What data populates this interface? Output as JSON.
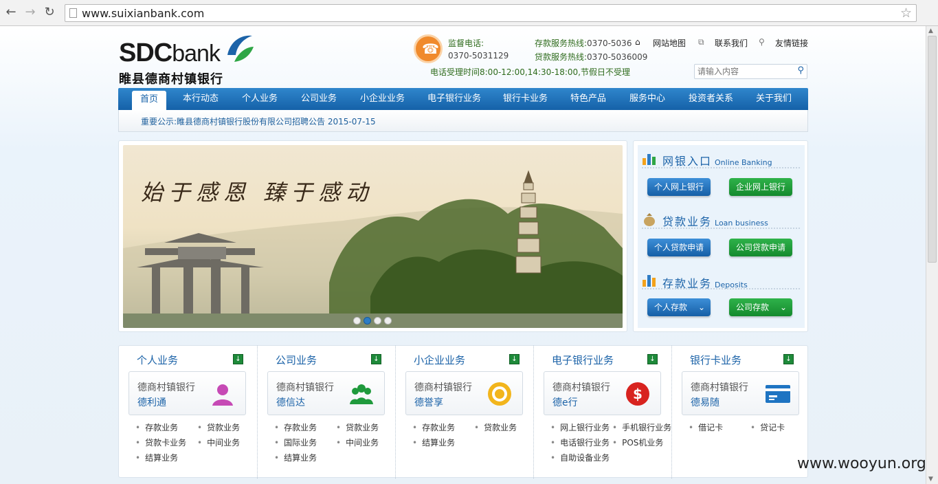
{
  "browser": {
    "url": "www.suixianbank.com"
  },
  "header": {
    "logo_en_bold": "SDC",
    "logo_en_rest": "bank",
    "logo_cn": "睢县德商村镇银行",
    "supervision_label": "监督电话:",
    "supervision_number": "0370-5031129",
    "deposit_hotline_label": "存款服务热线:",
    "deposit_hotline_number": "0370-5036",
    "loan_hotline_label": "贷款服务热线:",
    "loan_hotline_number": "0370-5036009",
    "hours": "电话受理时间8:00-12:00,14:30-18:00,节假日不受理",
    "top_links": [
      "网站地图",
      "联系我们",
      "友情链接"
    ],
    "search_placeholder": "请输入内容"
  },
  "nav": {
    "items": [
      "首页",
      "本行动态",
      "个人业务",
      "公司业务",
      "小企业业务",
      "电子银行业务",
      "银行卡业务",
      "特色产品",
      "服务中心",
      "投资者关系",
      "关于我们"
    ]
  },
  "notice": "重要公示:睢县德商村镇银行股份有限公司招聘公告 2015-07-15",
  "banner": {
    "slogan": "始于感恩 臻于感动"
  },
  "side": {
    "online_banking": {
      "title": "网银入口",
      "en": "Online Banking",
      "btn1": "个人网上银行",
      "btn2": "企业网上银行"
    },
    "loan": {
      "title": "贷款业务",
      "en": "Loan business",
      "btn1": "个人贷款申请",
      "btn2": "公司贷款申请"
    },
    "deposit": {
      "title": "存款业务",
      "en": "Deposits",
      "btn1": "个人存款",
      "btn2": "公司存款"
    }
  },
  "columns": [
    {
      "title": "个人业务",
      "card_line1": "德商村镇银行",
      "card_line2": "德利通",
      "links": [
        "存款业务",
        "贷款业务",
        "贷款卡业务",
        "中间业务",
        "结算业务"
      ]
    },
    {
      "title": "公司业务",
      "card_line1": "德商村镇银行",
      "card_line2": "德信达",
      "links": [
        "存款业务",
        "贷款业务",
        "国际业务",
        "中间业务",
        "结算业务"
      ]
    },
    {
      "title": "小企业业务",
      "card_line1": "德商村镇银行",
      "card_line2": "德誉享",
      "links": [
        "存款业务",
        "贷款业务",
        "结算业务"
      ]
    },
    {
      "title": "电子银行业务",
      "card_line1": "德商村镇银行",
      "card_line2": "德e行",
      "links": [
        "网上银行业务",
        "手机银行业务",
        "电话银行业务",
        "POS机业务",
        "自助设备业务"
      ]
    },
    {
      "title": "银行卡业务",
      "card_line1": "德商村镇银行",
      "card_line2": "德易随",
      "links": [
        "借记卡",
        "贷记卡"
      ]
    }
  ],
  "watermark": "www.wooyun.org",
  "colors": {
    "nav_blue": "#1561a8",
    "accent_green": "#148a2d",
    "phone_orange": "#f08a2c"
  }
}
